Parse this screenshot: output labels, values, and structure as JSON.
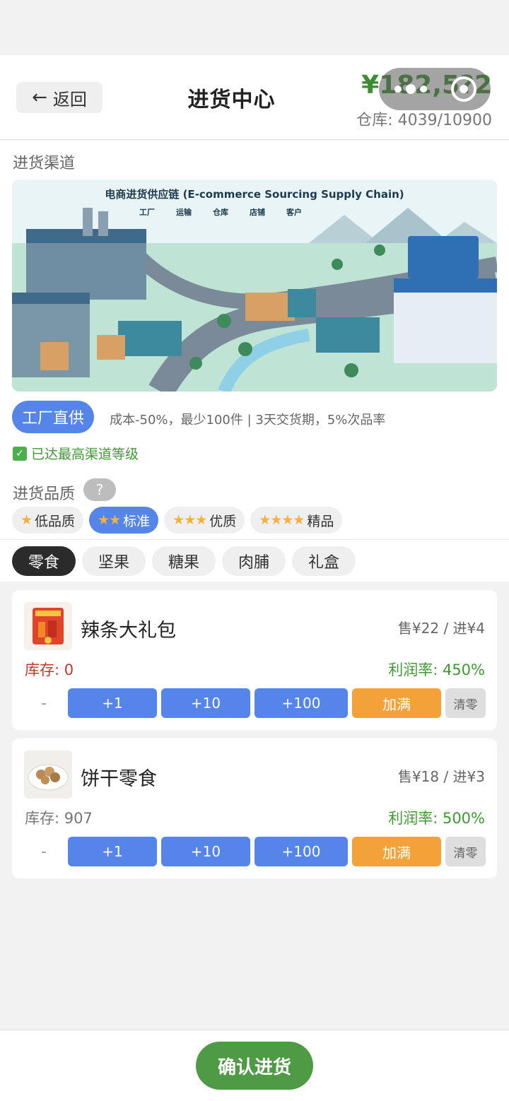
{
  "header": {
    "back_label": "返回",
    "title": "进货中心",
    "money": "¥182,5?2",
    "warehouse": "仓库: 4039/10900"
  },
  "channel": {
    "section_title": "进货渠道",
    "banner_title": "电商进货供应链 (E-commerce Sourcing Supply Chain)",
    "flow": [
      "工厂",
      "运输",
      "仓库",
      "店铺",
      "客户"
    ],
    "tag": "工厂直供",
    "desc": "成本-50%，最少100件 | 3天交货期，5%次品率",
    "max_level": "已达最高渠道等级"
  },
  "quality": {
    "section_title": "进货品质",
    "help": "?",
    "options": [
      {
        "stars": "★",
        "label": "低品质"
      },
      {
        "stars": "★★",
        "label": "标准"
      },
      {
        "stars": "★★★",
        "label": "优质"
      },
      {
        "stars": "★★★★",
        "label": "精品"
      }
    ]
  },
  "categories": [
    "零食",
    "坚果",
    "糖果",
    "肉脯",
    "礼盒"
  ],
  "products": [
    {
      "name": "辣条大礼包",
      "price": "售¥22 / 进¥4",
      "stock": "库存: 0",
      "profit": "利润率: 450%"
    },
    {
      "name": "饼干零食",
      "price": "售¥18 / 进¥3",
      "stock": "库存: 907",
      "profit": "利润率: 500%"
    }
  ],
  "actions": {
    "minus": "-",
    "plus1": "+1",
    "plus10": "+10",
    "plus100": "+100",
    "fill": "加满",
    "clear": "清零"
  },
  "footer": {
    "confirm": "确认进货"
  }
}
